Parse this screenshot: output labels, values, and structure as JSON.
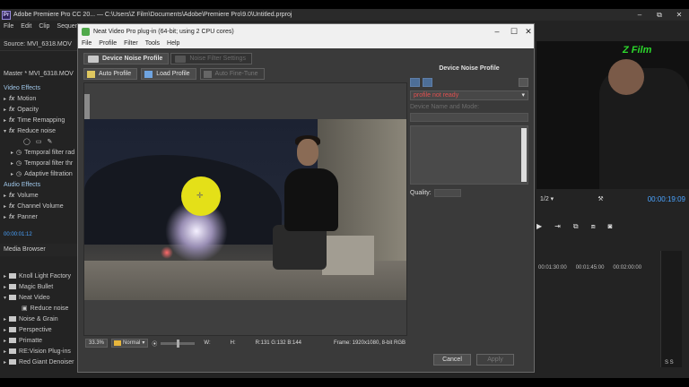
{
  "premiere": {
    "title": "Adobe Premiere Pro CC 20... — C:\\Users\\Z Film\\Documents\\Adobe\\Premiere Pro\\9.0\\Untitled.prproj",
    "logo": "Pr",
    "menu": [
      "File",
      "Edit",
      "Clip",
      "Sequence"
    ],
    "window_controls": [
      "–",
      "⧉",
      "✕"
    ]
  },
  "effect_controls": {
    "source": "Source: MVI_6318.MOV",
    "master": "Master * MVI_6318.MOV",
    "rows": [
      {
        "label": "Video Effects",
        "kind": "section"
      },
      {
        "label": "Motion",
        "kind": "fx"
      },
      {
        "label": "Opacity",
        "kind": "fx"
      },
      {
        "label": "Time Remapping",
        "kind": "fx"
      },
      {
        "label": "Reduce noise",
        "kind": "fx"
      },
      {
        "label": "",
        "kind": "icons"
      },
      {
        "label": "Temporal filter rad",
        "kind": "param"
      },
      {
        "label": "Temporal filter thr",
        "kind": "param"
      },
      {
        "label": "Adaptive filtration",
        "kind": "param"
      },
      {
        "label": "Audio Effects",
        "kind": "section"
      },
      {
        "label": "Volume",
        "kind": "fx"
      },
      {
        "label": "Channel Volume",
        "kind": "fx"
      },
      {
        "label": "Panner",
        "kind": "fx"
      }
    ],
    "timecode": "00:00:01:12"
  },
  "media_browser": {
    "title": "Media Browser",
    "items": [
      "Knoll Light Factory",
      "Magic Bullet",
      "Neat Video",
      "Reduce noise",
      "Noise & Grain",
      "Perspective",
      "Primatte",
      "RE:Vision Plug-ins",
      "Red Giant Denoiser"
    ]
  },
  "program_monitor": {
    "watermark": "Z Film",
    "resolution": "1/2",
    "timecode": "00:00:19:09",
    "timeline_marks": [
      "00:01:30:00",
      "00:01:45:00",
      "00:02:00:00"
    ],
    "meter_values": "S S"
  },
  "dialog": {
    "title": "Neat Video Pro plug-in (64-bit; using 2 CPU cores)",
    "menu": [
      "File",
      "Profile",
      "Filter",
      "Tools",
      "Help"
    ],
    "window_controls": [
      "–",
      "☐",
      "✕"
    ],
    "tabs": [
      {
        "label": "Device Noise Profile",
        "active": true
      },
      {
        "label": "Noise Filter Settings",
        "active": false
      }
    ],
    "tools": [
      {
        "label": "Auto Profile",
        "enabled": true,
        "icon": "wand-icon"
      },
      {
        "label": "Load Profile",
        "enabled": true,
        "icon": "folder-open-icon"
      },
      {
        "label": "Auto Fine-Tune",
        "enabled": false,
        "icon": "tune-icon"
      }
    ],
    "side_panel": {
      "title": "Device Noise Profile",
      "profile_status": "profile not ready",
      "device_label": "Device Name and Mode:",
      "quality_label": "Quality:"
    },
    "viewer_bar": {
      "zoom": "33.3%",
      "mode": "Normal",
      "w_label": "W:",
      "h_label": "H:",
      "rgb": "R:131 G:132 B:144",
      "frame_info": "Frame: 1920x1080, 8-bit RGB"
    },
    "footer": {
      "cancel": "Cancel",
      "apply": "Apply"
    }
  },
  "colors": {
    "accent": "#4aa3ff",
    "watermark": "#2cd82c",
    "warning": "#e05050",
    "sample_marker": "#e4e018"
  }
}
